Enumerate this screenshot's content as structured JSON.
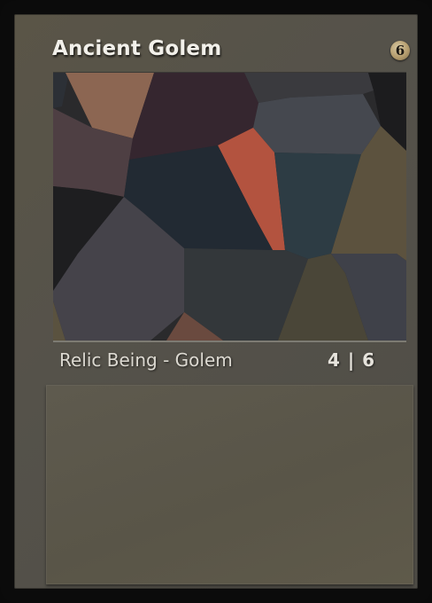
{
  "card": {
    "name": "Ancient Golem",
    "cost": "6",
    "type_line": "Relic Being - Golem",
    "stats": "4 | 6",
    "rules_text": ""
  },
  "colors": {
    "frame": "#56534a",
    "border": "#0b0b0b",
    "cost_gem": "#b59d6e",
    "art_palette": [
      "#8c6652",
      "#35262f",
      "#4e3f43",
      "#222a33",
      "#b3533f",
      "#2d3c44",
      "#5c523e",
      "#45434a",
      "#33373a",
      "#4a4638",
      "#3f4149",
      "#1c1c1e",
      "#6a4a3f"
    ]
  }
}
